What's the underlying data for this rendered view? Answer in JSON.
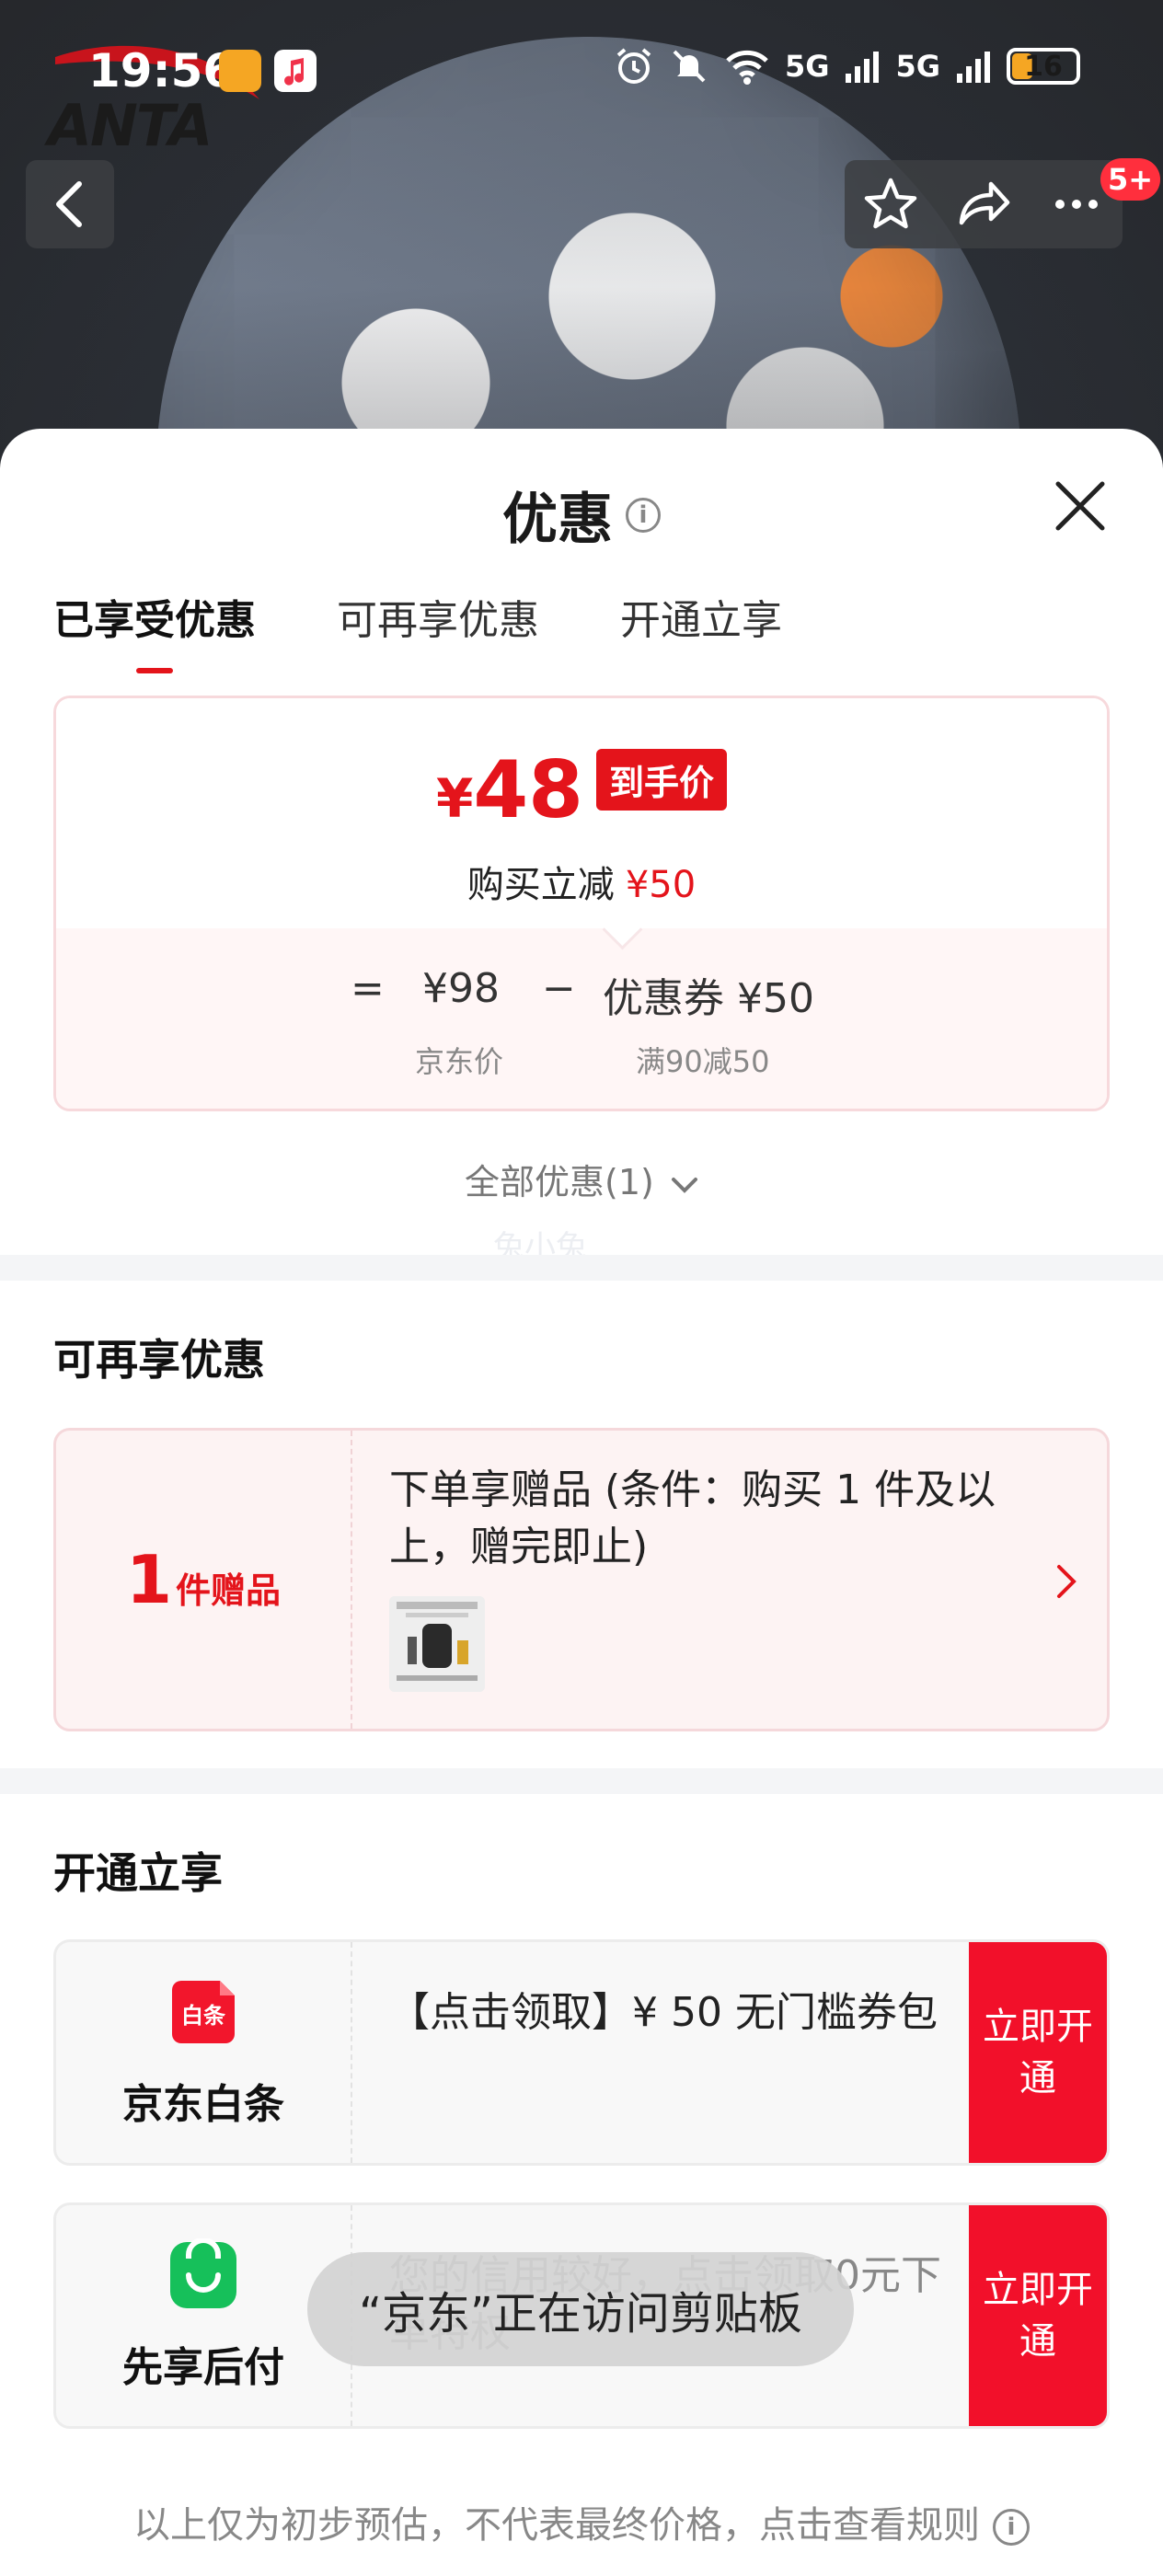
{
  "status_bar": {
    "time": "19:56",
    "signal_1": "5G",
    "signal_2": "5G",
    "battery": "16"
  },
  "background": {
    "brand_logo": "ANTA"
  },
  "top_nav": {
    "badge": "5+"
  },
  "sheet": {
    "title": "优惠",
    "tabs": [
      {
        "label": "已享受优惠",
        "active": true
      },
      {
        "label": "可再享优惠",
        "active": false
      },
      {
        "label": "开通立享",
        "active": false
      }
    ],
    "price_card": {
      "currency": "¥",
      "final_price": "48",
      "final_price_tag": "到手价",
      "discount_label": "购买立减",
      "discount_value": "¥50",
      "equals": "=",
      "jd_price": "¥98",
      "minus": "−",
      "coupon": "优惠券 ¥50",
      "jd_price_label": "京东价",
      "coupon_rule": "满90减50"
    },
    "all_offers": "全部优惠(1)",
    "watermark": "兔小兔"
  },
  "more_offers": {
    "title": "可再享优惠",
    "gift": {
      "count": "1",
      "unit": "件赠品",
      "text": "下单享赠品 (条件：购买 1 件及以上，赠完即止)"
    }
  },
  "open_to_enjoy": {
    "title": "开通立享",
    "items": [
      {
        "name": "京东白条",
        "logo_text": "白条",
        "text": "【点击领取】¥ 50 无门槛券包",
        "button": "立即开通"
      },
      {
        "name": "先享后付",
        "text": "您的信用较好，点击领取0元下单特权",
        "button": "立即开通"
      }
    ]
  },
  "toast": "“京东”正在访问剪贴板",
  "footer_note": "以上仅为初步预估，不代表最终价格，点击查看规则",
  "colors": {
    "accent_red": "#e4141b",
    "button_red": "#f2102a",
    "green": "#16c05a"
  }
}
